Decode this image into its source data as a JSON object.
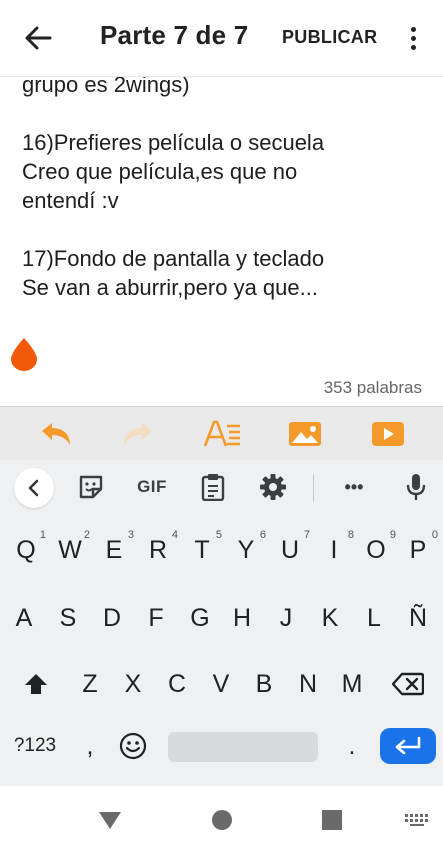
{
  "header": {
    "title": "Parte 7 de 7",
    "publish_label": "PUBLICAR"
  },
  "editor": {
    "lines": [
      "grupo es 2wings)",
      "",
      "16)Prefieres película o secuela",
      "Creo que película,es que no",
      "entendí :v",
      "",
      "17)Fondo de pantalla y teclado",
      "Se van a aburrir,pero ya que..."
    ],
    "word_count": "353 palabras"
  },
  "colors": {
    "accent_orange": "#f39a2b",
    "drop_orange": "#f25a0a",
    "enter_blue": "#1a73e8"
  },
  "format_toolbar": {
    "icons": [
      "undo-icon",
      "redo-icon",
      "text-format-icon",
      "image-icon",
      "video-icon"
    ]
  },
  "keyboard": {
    "toolbar_icons": [
      "back-icon",
      "sticker-icon",
      "gif-icon",
      "clipboard-icon",
      "gear-icon",
      "more-icon",
      "mic-icon"
    ],
    "gif_label": "GIF",
    "more_label": "•••",
    "row1": [
      {
        "k": "Q",
        "h": "1"
      },
      {
        "k": "W",
        "h": "2"
      },
      {
        "k": "E",
        "h": "3"
      },
      {
        "k": "R",
        "h": "4"
      },
      {
        "k": "T",
        "h": "5"
      },
      {
        "k": "Y",
        "h": "6"
      },
      {
        "k": "U",
        "h": "7"
      },
      {
        "k": "I",
        "h": "8"
      },
      {
        "k": "O",
        "h": "9"
      },
      {
        "k": "P",
        "h": "0"
      }
    ],
    "row2": [
      "A",
      "S",
      "D",
      "F",
      "G",
      "H",
      "J",
      "K",
      "L",
      "Ñ"
    ],
    "row3": [
      "Z",
      "X",
      "C",
      "V",
      "B",
      "N",
      "M"
    ],
    "symbols_label": "?123",
    "comma": ",",
    "period": "."
  },
  "navbar": {
    "icons": [
      "back-triangle-icon",
      "home-circle-icon",
      "recents-square-icon",
      "keyboard-switch-icon"
    ]
  }
}
